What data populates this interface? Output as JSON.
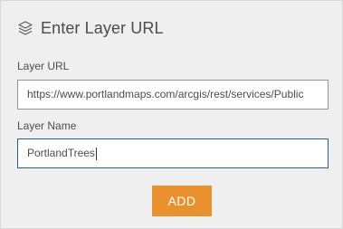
{
  "header": {
    "icon": "layers-icon",
    "title": "Enter Layer URL"
  },
  "layer_url": {
    "label": "Layer URL",
    "value": "https://www.portlandmaps.com/arcgis/rest/services/Public"
  },
  "layer_name": {
    "label": "Layer Name",
    "value": "PortlandTrees"
  },
  "actions": {
    "add_label": "ADD",
    "add_color": "#e8912e"
  }
}
